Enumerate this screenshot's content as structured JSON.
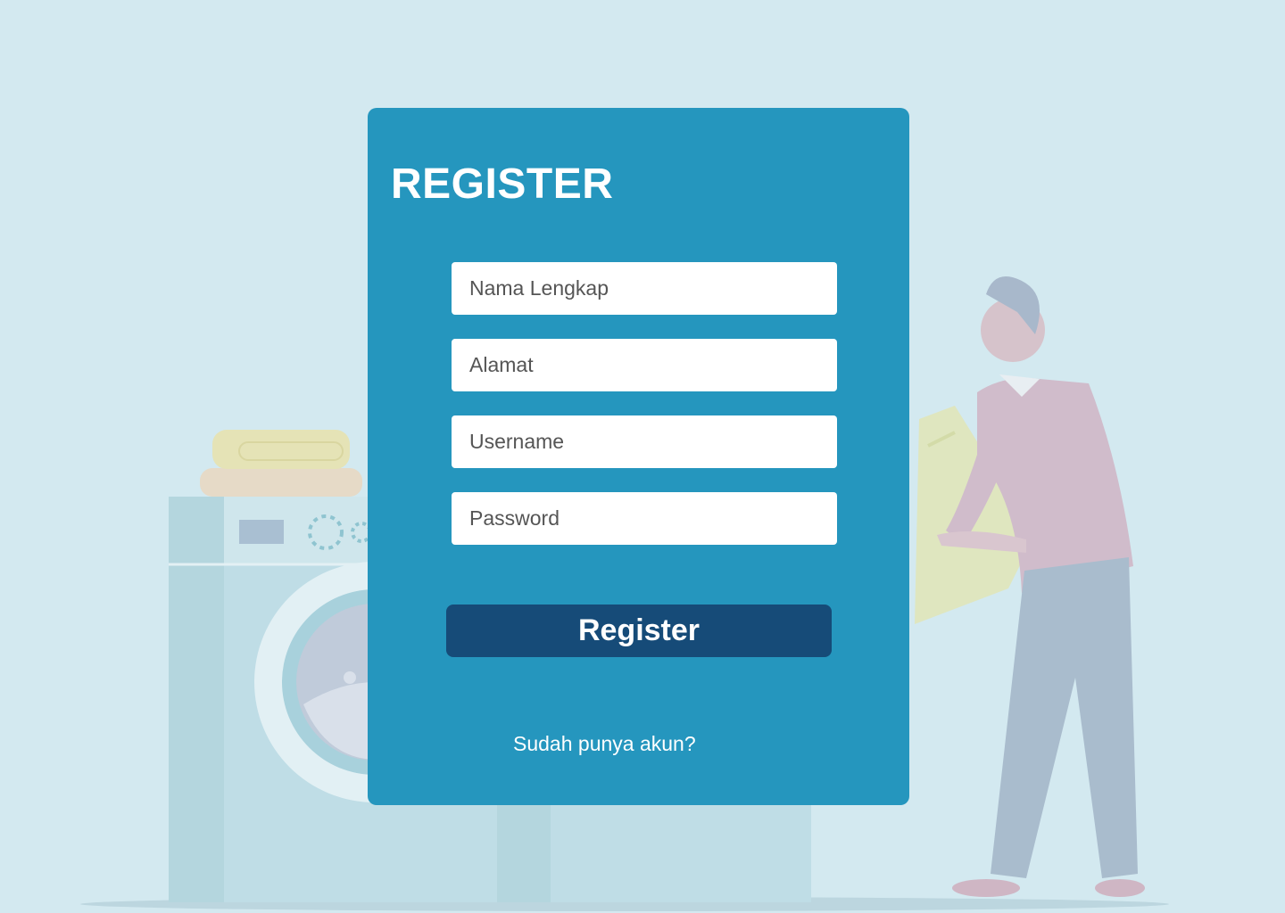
{
  "form": {
    "title": "REGISTER",
    "fields": [
      {
        "placeholder": "Nama Lengkap",
        "value": ""
      },
      {
        "placeholder": "Alamat",
        "value": ""
      },
      {
        "placeholder": "Username",
        "value": ""
      },
      {
        "placeholder": "Password",
        "value": ""
      }
    ],
    "submit_label": "Register",
    "login_link": "Sudah punya akun?"
  },
  "colors": {
    "background": "#d3e9f0",
    "card": "#2596be",
    "button": "#164b78",
    "text": "#ffffff"
  },
  "icons": [
    "washing-machine-illustration",
    "person-with-laundry-illustration"
  ]
}
